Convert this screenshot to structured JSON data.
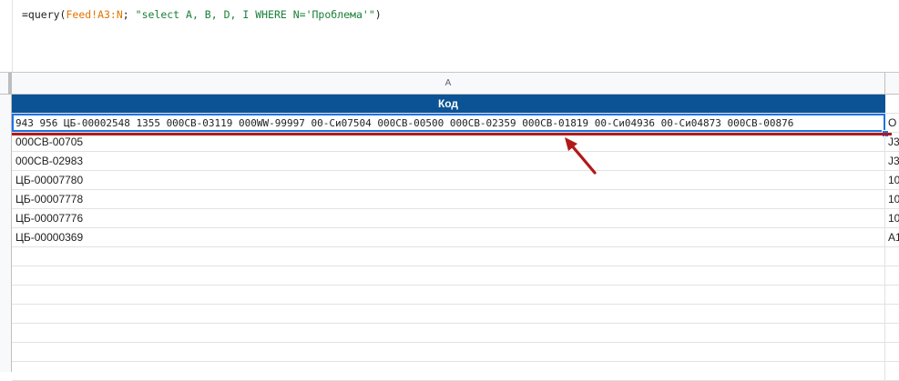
{
  "formula": {
    "prefix": "=query(",
    "range": "Feed!A3:N",
    "separator": "; ",
    "query_string": "\"select A, B, D, I WHERE N='Проблема'\"",
    "suffix": ")"
  },
  "columns": {
    "a_header": "A"
  },
  "table": {
    "header_label": "Код",
    "selected_cell": "943 956 ЦБ-00002548 1355 000СВ-03119 000WW-99997 00-Си07504 000СВ-00500 000СВ-02359 000СВ-01819 00-Си04936 00-Си04873 000СВ-00876",
    "selected_cell_b": "O",
    "rows": [
      {
        "a": "000СВ-00705",
        "b": "J3"
      },
      {
        "a": "000СВ-02983",
        "b": "J3"
      },
      {
        "a": "ЦБ-00007780",
        "b": "10"
      },
      {
        "a": "ЦБ-00007778",
        "b": "10"
      },
      {
        "a": "ЦБ-00007776",
        "b": "10"
      },
      {
        "a": "ЦБ-00000369",
        "b": "A1"
      }
    ]
  },
  "annotation": {
    "color": "#b11919"
  },
  "colors": {
    "header_fill": "#0b5394",
    "selection": "#1a73e8"
  }
}
